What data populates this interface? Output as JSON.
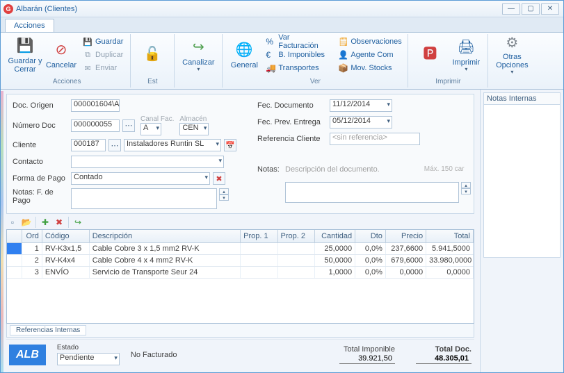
{
  "window": {
    "title": "Albarán (Clientes)"
  },
  "tab_main": "Acciones",
  "ribbon": {
    "acciones": {
      "label": "Acciones",
      "guardar_cerrar": "Guardar y Cerrar",
      "cancelar": "Cancelar",
      "guardar": "Guardar",
      "duplicar": "Duplicar",
      "enviar": "Enviar"
    },
    "est": {
      "label": "Est"
    },
    "canalizar": "Canalizar",
    "general": "General",
    "ver": {
      "label": "Ver",
      "var_fact": "Var Facturación",
      "b_imp": "B. Imponibles",
      "transportes": "Transportes",
      "observ": "Observaciones",
      "agente": "Agente Com",
      "mov": "Mov. Stocks"
    },
    "imprimir": {
      "label": "Imprimir",
      "btn": "Imprimir"
    },
    "otras": "Otras Opciones"
  },
  "form": {
    "doc_origen_l": "Doc. Origen",
    "doc_origen": "000001604\\A",
    "num_doc_l": "Número Doc",
    "num_doc": "000000055",
    "canal_fac_l": "Canal Fac.",
    "canal_fac": "A",
    "almacen_l": "Almacén",
    "almacen": "CEN",
    "cliente_l": "Cliente",
    "cliente_cod": "000187",
    "cliente_nom": "Instaladores Runtin SL",
    "contacto_l": "Contacto",
    "forma_pago_l": "Forma de Pago",
    "forma_pago": "Contado",
    "notas_pago_l": "Notas: F. de Pago",
    "fec_doc_l": "Fec. Documento",
    "fec_doc": "11/12/2014",
    "fec_prev_l": "Fec. Prev. Entrega",
    "fec_prev": "05/12/2014",
    "ref_cli_l": "Referencia Cliente",
    "ref_cli_ph": "<sin referencia>",
    "notas_l": "Notas:",
    "notas_ph": "Descripción del documento.",
    "maxchar": "Máx. 150 car"
  },
  "grid": {
    "h_ord": "Ord",
    "h_cod": "Código",
    "h_desc": "Descripción",
    "h_p1": "Prop. 1",
    "h_p2": "Prop. 2",
    "h_cant": "Cantidad",
    "h_dto": "Dto",
    "h_prec": "Precio",
    "h_tot": "Total",
    "rows": [
      {
        "ord": "1",
        "cod": "RV-K3x1,5",
        "desc": "Cable Cobre 3 x 1,5 mm2 RV-K",
        "cant": "25,0000",
        "dto": "0,0%",
        "prec": "237,6600",
        "tot": "5.941,5000"
      },
      {
        "ord": "2",
        "cod": "RV-K4x4",
        "desc": "Cable Cobre 4 x 4 mm2 RV-K",
        "cant": "50,0000",
        "dto": "0,0%",
        "prec": "679,6000",
        "tot": "33.980,0000"
      },
      {
        "ord": "3",
        "cod": "ENVÍO",
        "desc": "Servicio de Transporte Seur 24",
        "cant": "1,0000",
        "dto": "0,0%",
        "prec": "0,0000",
        "tot": "0,0000"
      }
    ]
  },
  "bottom_tab": "Referencias Internas",
  "footer": {
    "alb": "ALB",
    "estado_l": "Estado",
    "estado": "Pendiente",
    "fact": "No Facturado",
    "t_imp_l": "Total Imponible",
    "t_imp": "39.921,50",
    "t_doc_l": "Total Doc.",
    "t_doc": "48.305,01"
  },
  "side": {
    "title": "Notas Internas"
  }
}
